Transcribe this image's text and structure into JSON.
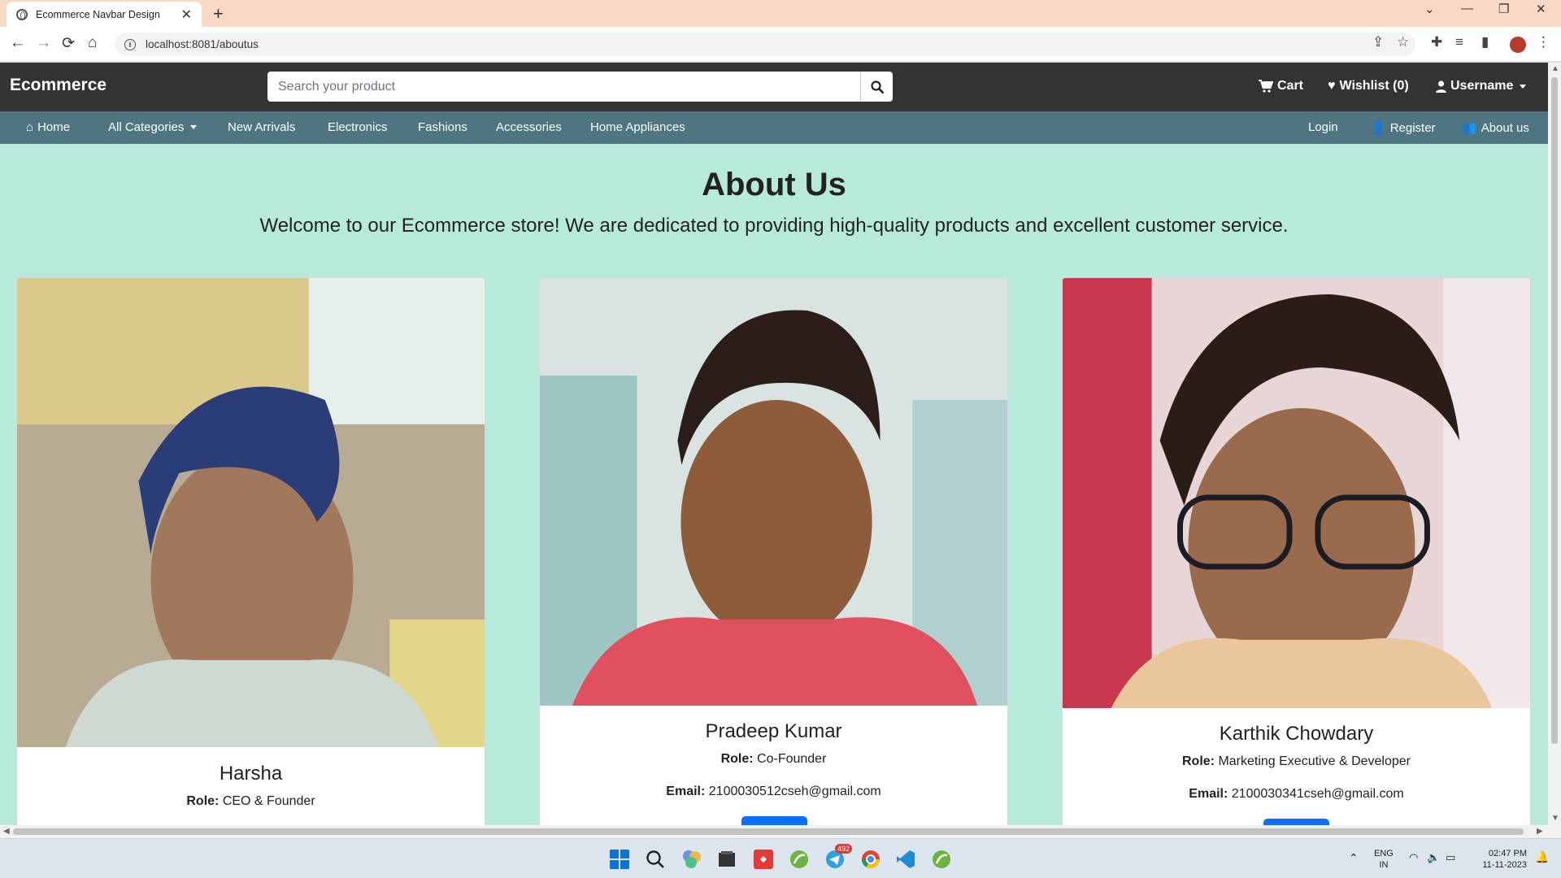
{
  "browser": {
    "tab_title": "Ecommerce Navbar Design",
    "tab_close": "✕",
    "new_tab": "+",
    "url": "localhost:8081/aboutus"
  },
  "site": {
    "brand": "Ecommerce",
    "search_placeholder": "Search your product",
    "cart_label": "Cart",
    "wishlist_label": "Wishlist (0)",
    "user_label": "Username"
  },
  "catnav": {
    "home": "Home",
    "all_categories": "All Categories",
    "new_arrivals": "New Arrivals",
    "electronics": "Electronics",
    "fashions": "Fashions",
    "accessories": "Accessories",
    "home_appliances": "Home Appliances",
    "login": "Login",
    "register": "Register",
    "about": "About us"
  },
  "about": {
    "title": "About Us",
    "subtitle": "Welcome to our Ecommerce store! We are dedicated to providing high-quality products and excellent customer service."
  },
  "team": [
    {
      "name": "Harsha",
      "role_label": "Role:",
      "role": "CEO & Founder",
      "email_label": "",
      "email": ""
    },
    {
      "name": "Pradeep Kumar",
      "role_label": "Role:",
      "role": "Co-Founder",
      "email_label": "Email:",
      "email": "2100030512cseh@gmail.com"
    },
    {
      "name": "Karthik Chowdary",
      "role_label": "Role:",
      "role": "Marketing Executive & Developer",
      "email_label": "Email:",
      "email": "2100030341cseh@gmail.com"
    }
  ],
  "taskbar": {
    "lang": "ENG",
    "region": "IN",
    "time": "02:47 PM",
    "date": "11-11-2023",
    "telegram_badge": "492"
  },
  "colors": {
    "page_bg": "#b7eadb",
    "topnav_bg": "#333333",
    "catnav_bg": "#4f7580",
    "button_blue": "#0d6efd",
    "tab_strip": "#f9d8c6"
  }
}
